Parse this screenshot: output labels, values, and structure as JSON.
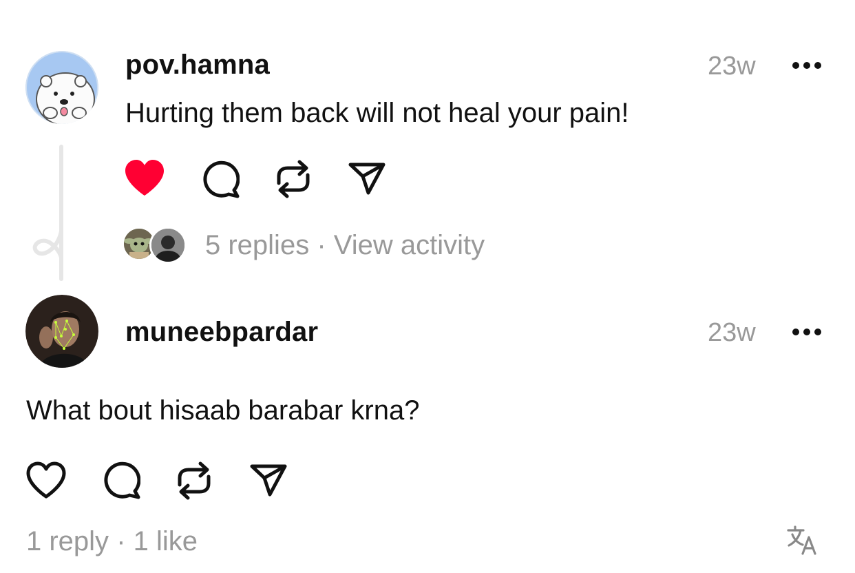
{
  "post": {
    "username": "pov.hamna",
    "time": "23w",
    "text": "Hurting them back will not heal your pain!",
    "replies_text": "5 replies",
    "separator": "·",
    "activity_text": "View activity",
    "liked": true,
    "like_color": "#ff0033",
    "avatar_color": "#a7c8f2"
  },
  "reply": {
    "username": "muneebpardar",
    "time": "23w",
    "text": "What bout hisaab barabar krna?",
    "replies_text": "1 reply",
    "separator": "·",
    "likes_text": "1 like",
    "liked": false
  },
  "icons": [
    "heart-icon",
    "comment-icon",
    "repost-icon",
    "share-icon",
    "more-icon",
    "translate-icon"
  ],
  "colors": {
    "text": "#111111",
    "muted": "#999999",
    "thread_line": "#e6e6e6"
  }
}
